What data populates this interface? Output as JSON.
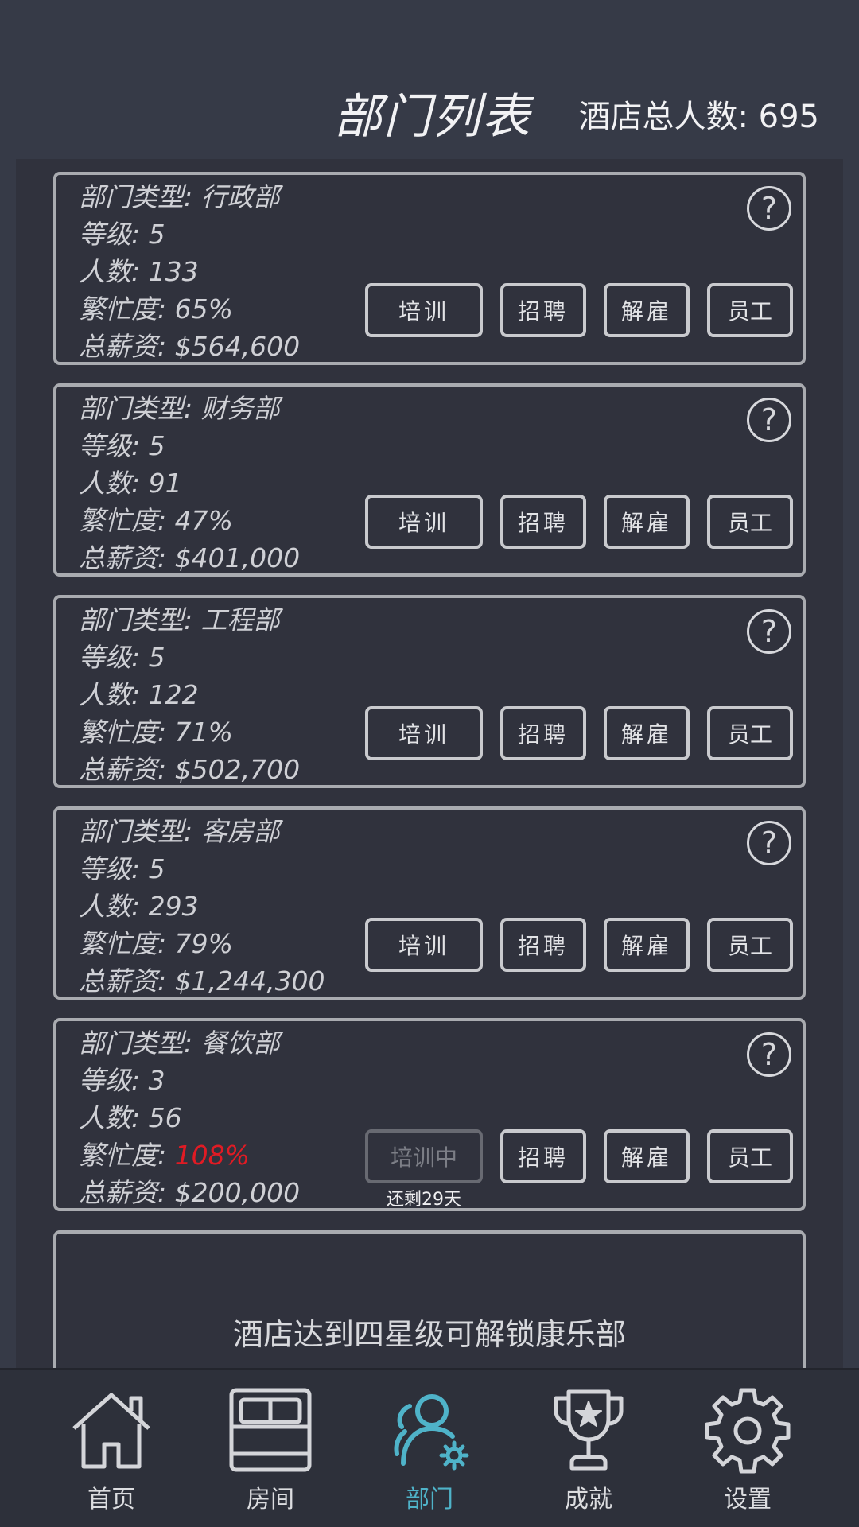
{
  "header": {
    "title": "部门列表",
    "total_staff": "酒店总人数: 695"
  },
  "buttons": {
    "train": "培训",
    "recruit": "招聘",
    "fire": "解雇",
    "staff": "员工",
    "help": "?"
  },
  "departments": [
    {
      "type": "部门类型: 行政部",
      "level": "等级: 5",
      "headcount": "人数: 133",
      "busy_label": "繁忙度: ",
      "busy_value": "65%",
      "salary": "总薪资: $564,600"
    },
    {
      "type": "部门类型: 财务部",
      "level": "等级: 5",
      "headcount": "人数: 91",
      "busy_label": "繁忙度: ",
      "busy_value": "47%",
      "salary": "总薪资: $401,000"
    },
    {
      "type": "部门类型: 工程部",
      "level": "等级: 5",
      "headcount": "人数: 122",
      "busy_label": "繁忙度: ",
      "busy_value": "71%",
      "salary": "总薪资: $502,700"
    },
    {
      "type": "部门类型: 客房部",
      "level": "等级: 5",
      "headcount": "人数: 293",
      "busy_label": "繁忙度: ",
      "busy_value": "79%",
      "salary": "总薪资: $1,244,300"
    },
    {
      "type": "部门类型: 餐饮部",
      "level": "等级: 3",
      "headcount": "人数: 56",
      "busy_label": "繁忙度: ",
      "busy_value": "108%",
      "busy_value_color": "#e01b24",
      "salary": "总薪资: $200,000",
      "train_status": "培训中",
      "train_remaining": "还剩29天"
    }
  ],
  "locked": {
    "text": "酒店达到四星级可解锁康乐部"
  },
  "nav": {
    "items": [
      {
        "label": "首页",
        "icon": "home-icon"
      },
      {
        "label": "房间",
        "icon": "bed-icon"
      },
      {
        "label": "部门",
        "icon": "people-gear-icon",
        "active": true
      },
      {
        "label": "成就",
        "icon": "trophy-icon"
      },
      {
        "label": "设置",
        "icon": "gear-icon"
      }
    ],
    "active_color": "#4fb3c9"
  }
}
